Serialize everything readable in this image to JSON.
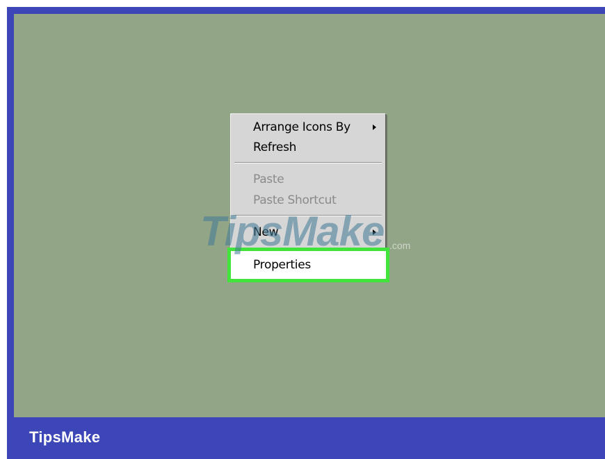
{
  "context_menu": {
    "items": [
      {
        "label": "Arrange Icons By",
        "has_submenu": true,
        "enabled": true
      },
      {
        "label": "Refresh",
        "has_submenu": false,
        "enabled": true
      },
      {
        "label": "Paste",
        "has_submenu": false,
        "enabled": false
      },
      {
        "label": "Paste Shortcut",
        "has_submenu": false,
        "enabled": false
      },
      {
        "label": "New",
        "has_submenu": true,
        "enabled": true
      },
      {
        "label": "Properties",
        "has_submenu": false,
        "enabled": true,
        "highlighted": true
      }
    ]
  },
  "footer": {
    "brand": "TipsMake"
  },
  "watermark": {
    "text": "TipsMake",
    "suffix": ".com"
  },
  "colors": {
    "frame": "#3c46b6",
    "desktop": "#93a587",
    "menu_background": "#d6d6d6",
    "highlight_border": "#41e43a"
  }
}
